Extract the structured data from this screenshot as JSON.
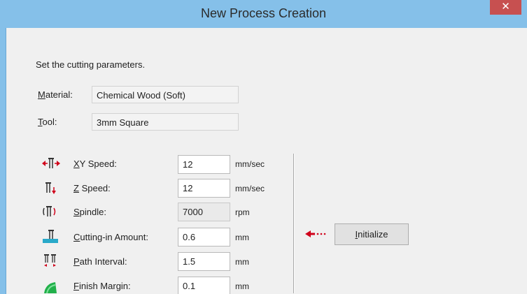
{
  "window": {
    "title": "New Process Creation",
    "close_glyph": "✕"
  },
  "instruction": "Set the cutting parameters.",
  "material": {
    "label": "Material:",
    "value": "Chemical Wood (Soft)"
  },
  "tool": {
    "label": "Tool:",
    "value": "3mm Square"
  },
  "params": {
    "xy_speed": {
      "label": "XY Speed:",
      "value": "12",
      "unit": "mm/sec"
    },
    "z_speed": {
      "label": "Z Speed:",
      "value": "12",
      "unit": "mm/sec"
    },
    "spindle": {
      "label": "Spindle:",
      "value": "7000",
      "unit": "rpm"
    },
    "cutting_in": {
      "label": "Cutting-in Amount:",
      "value": "0.6",
      "unit": "mm"
    },
    "path_interval": {
      "label": "Path Interval:",
      "value": "1.5",
      "unit": "mm"
    },
    "finish_margin": {
      "label": "Finish Margin:",
      "value": "0.1",
      "unit": "mm"
    }
  },
  "initialize": {
    "label": "Initialize"
  },
  "icons": [
    "xy-speed-icon",
    "z-speed-icon",
    "spindle-icon",
    "cutting-in-icon",
    "path-interval-icon",
    "finish-margin-icon",
    "red-arrow-left-icon"
  ],
  "colors": {
    "titlebar": "#85c0e9",
    "close_button": "#c75050",
    "arrow": "#d0021b"
  }
}
